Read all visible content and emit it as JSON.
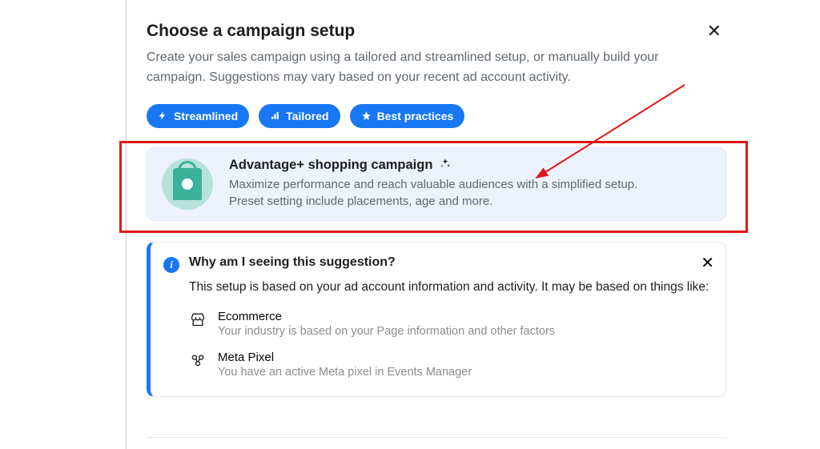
{
  "header": {
    "title": "Choose a campaign setup",
    "subtitle": "Create your sales campaign using a tailored and streamlined setup, or manually build your campaign. Suggestions may vary based on your recent ad account activity."
  },
  "chips": {
    "streamlined": "Streamlined",
    "tailored": "Tailored",
    "best_practices": "Best practices"
  },
  "option": {
    "title": "Advantage+ shopping campaign",
    "desc1": "Maximize performance and reach valuable audiences with a simplified setup.",
    "desc2": "Preset setting include placements, age and more."
  },
  "info": {
    "title": "Why am I seeing this suggestion?",
    "lead": "This setup is based on your ad account information and activity. It may be based on things like:",
    "reasons": [
      {
        "title": "Ecommerce",
        "sub": "Your industry is based on your Page information and other factors"
      },
      {
        "title": "Meta Pixel",
        "sub": "You have an active Meta pixel in Events Manager"
      }
    ]
  }
}
